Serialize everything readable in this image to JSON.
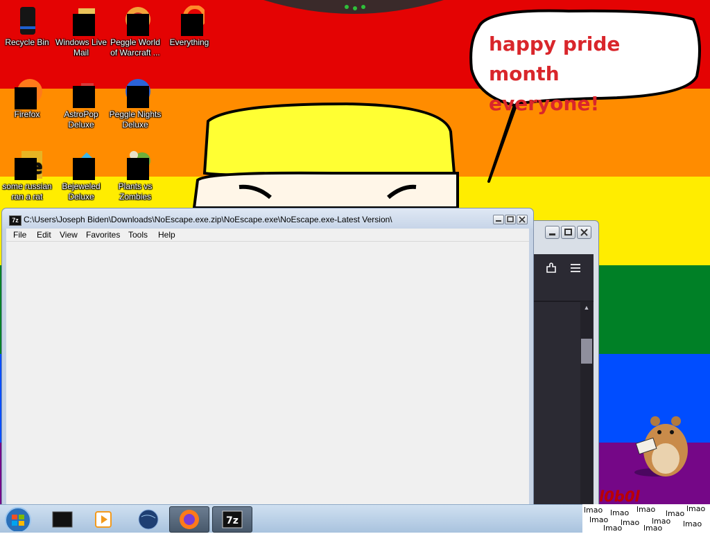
{
  "wallpaper": {
    "stripes": [
      "#e40303",
      "#ff8c00",
      "#ffed00",
      "#008026",
      "#004dff",
      "#750787"
    ],
    "speech_bubble": {
      "line1": "happy pride month",
      "line2": "everyone!"
    }
  },
  "desktop_icons": [
    {
      "id": "recycle-bin",
      "label": "Recycle Bin"
    },
    {
      "id": "windows-live-mail",
      "label": "Windows Live Mail"
    },
    {
      "id": "peggle-world-of-warcraft",
      "label": "Peggle World of Warcraft ..."
    },
    {
      "id": "everything",
      "label": "Everything"
    },
    {
      "id": "firefox",
      "label": "Firefox"
    },
    {
      "id": "astropop-deluxe",
      "label": "AstroPop Deluxe"
    },
    {
      "id": "peggle-nights-deluxe",
      "label": "Peggle Nights Deluxe"
    },
    {
      "id": "some-russian-ran-a-rat",
      "label": "some russian ran a rat"
    },
    {
      "id": "bejeweled-deluxe",
      "label": "Bejeweled Deluxe"
    },
    {
      "id": "plants-vs-zombies",
      "label": "Plants vs Zombies"
    }
  ],
  "file_manager": {
    "app_icon_text": "7z",
    "title": "C:\\Users\\Joseph Biden\\Downloads\\NoEscape.exe.zip\\NoEscape.exe\\NoEscape.exe-Latest Version\\",
    "menu": [
      "File",
      "Edit",
      "View",
      "Favorites",
      "Tools",
      "Help"
    ]
  },
  "taskbar": {
    "items": [
      {
        "id": "start",
        "icon": "windows-orb-icon"
      },
      {
        "id": "black-box",
        "icon": "black-box-icon"
      },
      {
        "id": "media-player",
        "icon": "media-player-icon"
      },
      {
        "id": "globe",
        "icon": "globe-icon"
      },
      {
        "id": "firefox",
        "icon": "firefox-icon"
      },
      {
        "id": "7zip",
        "icon": "7zip-icon",
        "text": "7z"
      }
    ]
  },
  "tray": {
    "word": "lmao",
    "banner": "l0b0l"
  }
}
